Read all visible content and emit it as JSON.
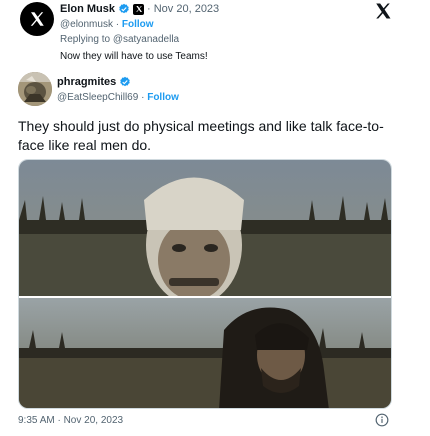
{
  "quoted_tweet": {
    "author_name": "Elon Musk",
    "date": "· Nov 20, 2023",
    "handle": "@elonmusk",
    "separator": "·",
    "follow_label": "Follow",
    "reply_prefix": "Replying to",
    "reply_mention": "@satyanadella",
    "text": "Now they will have to use Teams!",
    "avatar_icon": "x-logo-icon",
    "badge_icon": "verified-badge-icon",
    "affiliate_icon": "x-affiliate-icon"
  },
  "top_right_icon": "x-logo-icon",
  "tweet": {
    "author_name": "phragmites",
    "handle": "@EatSleepChill69",
    "separator": "·",
    "follow_label": "Follow",
    "text": "They should just do physical meetings and like talk face-to-face like real men do.",
    "badge_icon": "verified-badge-icon",
    "avatar_icon": "user-avatar"
  },
  "media": {
    "description_icon": "movie-still-image"
  },
  "footer": {
    "timestamp": "9:35 AM · Nov 20, 2023",
    "info_icon": "info-icon"
  },
  "colors": {
    "accent": "#1d9bf0",
    "text_primary": "#0f1419",
    "text_secondary": "#536471"
  }
}
